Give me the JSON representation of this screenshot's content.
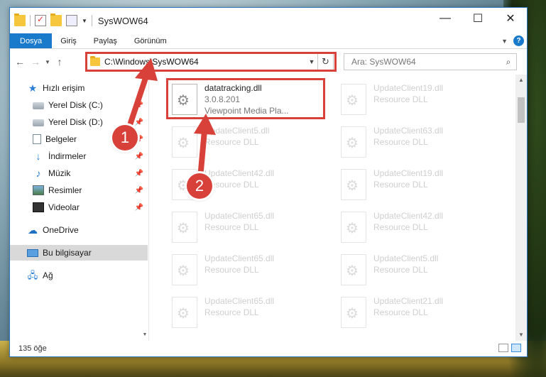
{
  "window": {
    "title": "SysWOW64",
    "minimize_glyph": "—",
    "maximize_glyph": "☐",
    "close_glyph": "✕"
  },
  "ribbon": {
    "tabs": [
      "Dosya",
      "Giriş",
      "Paylaş",
      "Görünüm"
    ],
    "help_glyph": "?"
  },
  "address": {
    "path": "C:\\Windows\\SysWOW64",
    "search_placeholder": "Ara: SysWOW64"
  },
  "nav": {
    "items": [
      {
        "label": "Hızlı erişim",
        "icon": "star-icon"
      },
      {
        "label": "Yerel Disk (C:)",
        "icon": "drive-icon"
      },
      {
        "label": "Yerel Disk (D:)",
        "icon": "drive-icon"
      },
      {
        "label": "Belgeler",
        "icon": "documents-icon"
      },
      {
        "label": "İndirmeler",
        "icon": "downloads-icon"
      },
      {
        "label": "Müzik",
        "icon": "music-icon"
      },
      {
        "label": "Resimler",
        "icon": "pictures-icon"
      },
      {
        "label": "Videolar",
        "icon": "videos-icon"
      },
      {
        "label": "OneDrive",
        "icon": "cloud-icon"
      },
      {
        "label": "Bu bilgisayar",
        "icon": "computer-icon"
      },
      {
        "label": "Ağ",
        "icon": "network-icon"
      }
    ]
  },
  "files": {
    "col1": [
      {
        "name": "datatracking.dll",
        "line2": "3.0.8.201",
        "line3": "Viewpoint Media Pla..."
      },
      {
        "name": "UpdateClient5.dll",
        "line2": "Resource DLL"
      },
      {
        "name": "UpdateClient42.dll",
        "line2": "Resource DLL"
      },
      {
        "name": "UpdateClient65.dll",
        "line2": "Resource DLL"
      },
      {
        "name": "UpdateClient65.dll",
        "line2": "Resource DLL"
      },
      {
        "name": "UpdateClient65.dll",
        "line2": "Resource DLL"
      }
    ],
    "col2": [
      {
        "name": "UpdateClient19.dll",
        "line2": "Resource DLL"
      },
      {
        "name": "UpdateClient63.dll",
        "line2": "Resource DLL"
      },
      {
        "name": "UpdateClient19.dll",
        "line2": "Resource DLL"
      },
      {
        "name": "UpdateClient42.dll",
        "line2": "Resource DLL"
      },
      {
        "name": "UpdateClient5.dll",
        "line2": "Resource DLL"
      },
      {
        "name": "UpdateClient21.dll",
        "line2": "Resource DLL"
      }
    ]
  },
  "status": {
    "count": "135 öğe"
  },
  "annotations": {
    "badge1": "1",
    "badge2": "2",
    "color": "#d8413a"
  }
}
